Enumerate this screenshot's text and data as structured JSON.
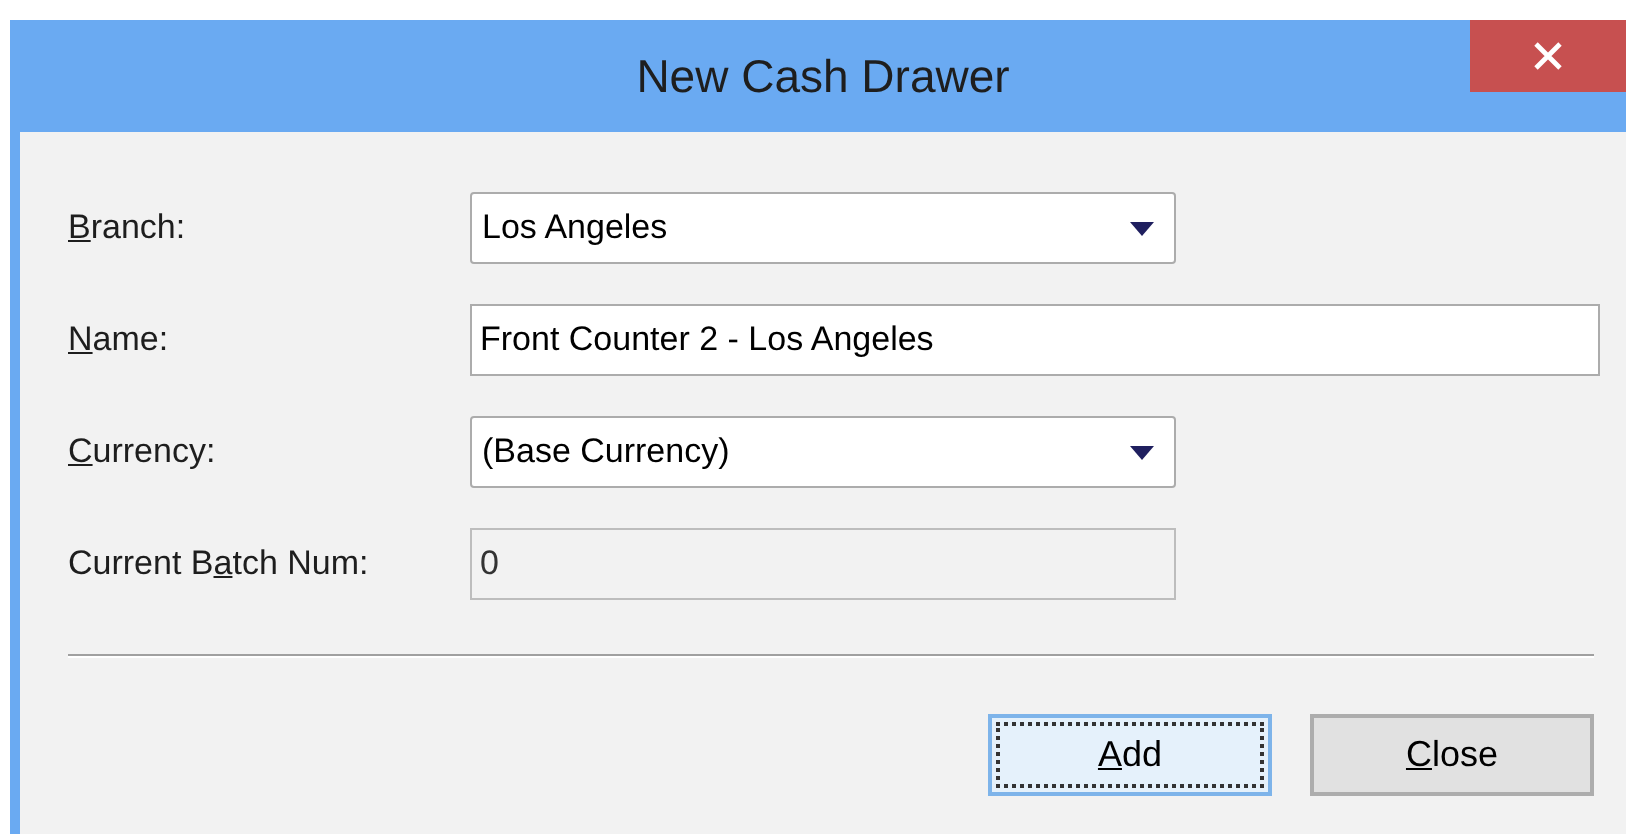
{
  "window": {
    "title": "New Cash Drawer"
  },
  "fields": [
    {
      "kind": "dropdown",
      "label": {
        "key": "B",
        "post": "ranch:"
      },
      "value": "Los Angeles",
      "disabled": false
    },
    {
      "kind": "text",
      "label": {
        "key": "N",
        "post": "ame:"
      },
      "value": "Front Counter 2 - Los Angeles",
      "disabled": false
    },
    {
      "kind": "dropdown",
      "label": {
        "key": "C",
        "post": "urrency:"
      },
      "value": "(Base Currency)",
      "disabled": false
    },
    {
      "kind": "text",
      "label": {
        "pre": "Current B",
        "key": "a",
        "post": "tch Num:"
      },
      "value": "0",
      "disabled": true
    }
  ],
  "buttons": [
    {
      "label": {
        "key": "A",
        "post": "dd"
      },
      "selected": true
    },
    {
      "label": {
        "key": "C",
        "post": "lose"
      },
      "selected": false
    }
  ]
}
